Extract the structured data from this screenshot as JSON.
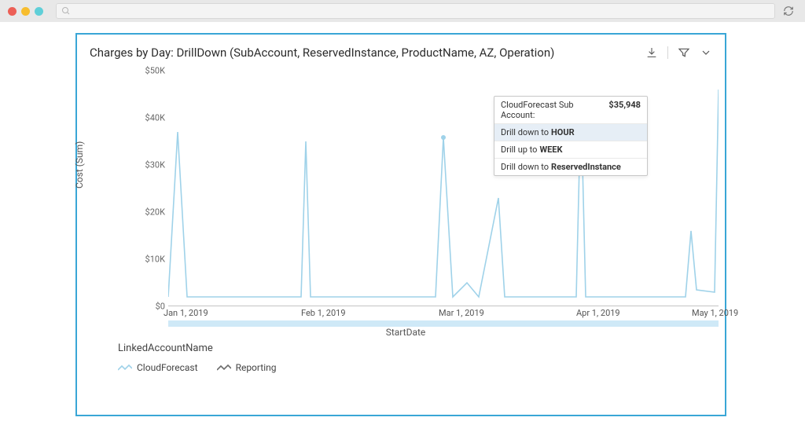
{
  "browser": {
    "refresh": "refresh"
  },
  "title": "Charges by Day: DrillDown (SubAccount, ReservedInstance, ProductName, AZ, Operation)",
  "ylabel": "Cost (Sum)",
  "xlabel": "StartDate",
  "yticks": [
    "$50K",
    "$40K",
    "$30K",
    "$20K",
    "$10K",
    "$0"
  ],
  "xticks": [
    "Jan 1, 2019",
    "Feb 1, 2019",
    "Mar 1, 2019",
    "Apr 1, 2019",
    "May 1, 2019"
  ],
  "drill": {
    "head_label": "CloudForecast Sub Account:",
    "head_value": "$35,948",
    "row2_a": "Drill down to",
    "row2_b": "HOUR",
    "row3_a": "Drill up to",
    "row3_b": "WEEK",
    "row4_a": "Drill down to",
    "row4_b": "ReservedInstance"
  },
  "legend": {
    "title": "LinkedAccountName",
    "items": [
      "CloudForecast",
      "Reporting"
    ]
  },
  "chart_data": {
    "type": "line",
    "title": "Charges by Day: DrillDown (SubAccount, ReservedInstance, ProductName, AZ, Operation)",
    "xlabel": "StartDate",
    "ylabel": "Cost (Sum)",
    "ylim": [
      0,
      50000
    ],
    "x_range": [
      "2019-01-01",
      "2019-05-01"
    ],
    "x_tick_labels": [
      "Jan 1, 2019",
      "Feb 1, 2019",
      "Mar 1, 2019",
      "Apr 1, 2019",
      "May 1, 2019"
    ],
    "y_tick_labels": [
      "$0",
      "$10K",
      "$20K",
      "$30K",
      "$40K",
      "$50K"
    ],
    "series": [
      {
        "name": "CloudForecast",
        "color": "#9fd2e9",
        "points": [
          {
            "x": "2019-01-01",
            "y": 2000
          },
          {
            "x": "2019-01-03",
            "y": 37000
          },
          {
            "x": "2019-01-05",
            "y": 2000
          },
          {
            "x": "2019-01-31",
            "y": 2000
          },
          {
            "x": "2019-02-01",
            "y": 35000
          },
          {
            "x": "2019-02-02",
            "y": 2000
          },
          {
            "x": "2019-02-28",
            "y": 2000
          },
          {
            "x": "2019-03-01",
            "y": 36000
          },
          {
            "x": "2019-03-03",
            "y": 2000
          },
          {
            "x": "2019-03-06",
            "y": 5000
          },
          {
            "x": "2019-03-08",
            "y": 2000
          },
          {
            "x": "2019-03-13",
            "y": 23000
          },
          {
            "x": "2019-03-14",
            "y": 2000
          },
          {
            "x": "2019-03-31",
            "y": 2000
          },
          {
            "x": "2019-04-01",
            "y": 44000
          },
          {
            "x": "2019-04-02",
            "y": 2000
          },
          {
            "x": "2019-04-23",
            "y": 2000
          },
          {
            "x": "2019-04-24",
            "y": 16000
          },
          {
            "x": "2019-04-25",
            "y": 3500
          },
          {
            "x": "2019-04-30",
            "y": 3000
          },
          {
            "x": "2019-05-01",
            "y": 46000
          }
        ]
      },
      {
        "name": "Reporting",
        "color": "#6c6c6c",
        "points": []
      }
    ],
    "tooltip": {
      "label": "CloudForecast Sub Account",
      "value": 35948,
      "value_formatted": "$35,948"
    },
    "drill_options": [
      "Drill down to HOUR",
      "Drill up to WEEK",
      "Drill down to ReservedInstance"
    ]
  }
}
